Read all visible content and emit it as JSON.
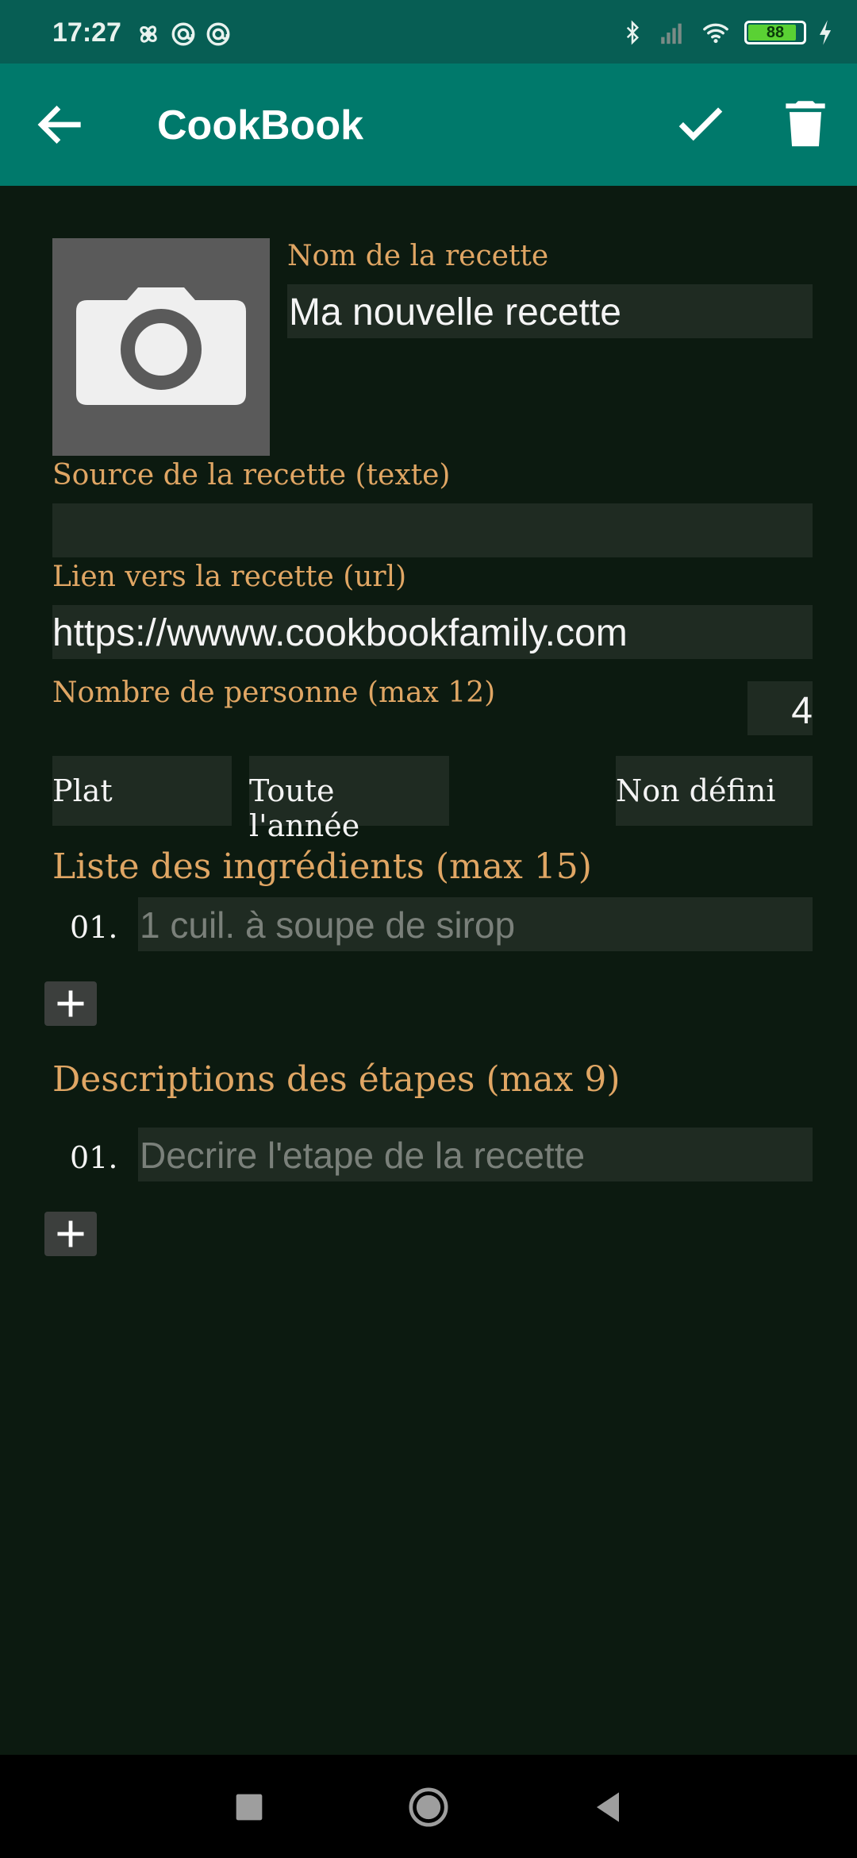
{
  "status_bar": {
    "time": "17:27",
    "battery": "88",
    "icons": [
      "fan-icon",
      "notification-icon",
      "notification-icon",
      "bluetooth-icon",
      "signal-icon",
      "wifi-icon",
      "battery-icon",
      "charging-icon"
    ]
  },
  "app_bar": {
    "title": "CookBook",
    "icons": [
      "back-arrow-icon",
      "check-icon",
      "trash-icon"
    ]
  },
  "form": {
    "photo_icon": "camera-icon",
    "name_label": "Nom de la recette",
    "name_value": "Ma nouvelle recette",
    "source_label": "Source de la recette (texte)",
    "source_value": "",
    "link_label": "Lien vers la recette (url)",
    "link_value": "https://wwww.cookbookfamily.com",
    "persons_label": "Nombre de personne (max 12)",
    "persons_value": "4",
    "category_value": "Plat",
    "season_value": "Toute l'année",
    "difficulty_value": "Non défini",
    "ingredients_label": "Liste des ingrédients (max 15)",
    "ingredients": [
      {
        "index": "01.",
        "placeholder": "1 cuil. à soupe de sirop"
      }
    ],
    "steps_label": "Descriptions des étapes (max 9)",
    "steps": [
      {
        "index": "01.",
        "placeholder": "Decrire l'etape de la recette"
      }
    ]
  },
  "colors": {
    "status_bar": "#075e54",
    "app_bar": "#00796b",
    "background": "#0c1a10",
    "field": "#1f2b22",
    "label": "#e0a664"
  }
}
